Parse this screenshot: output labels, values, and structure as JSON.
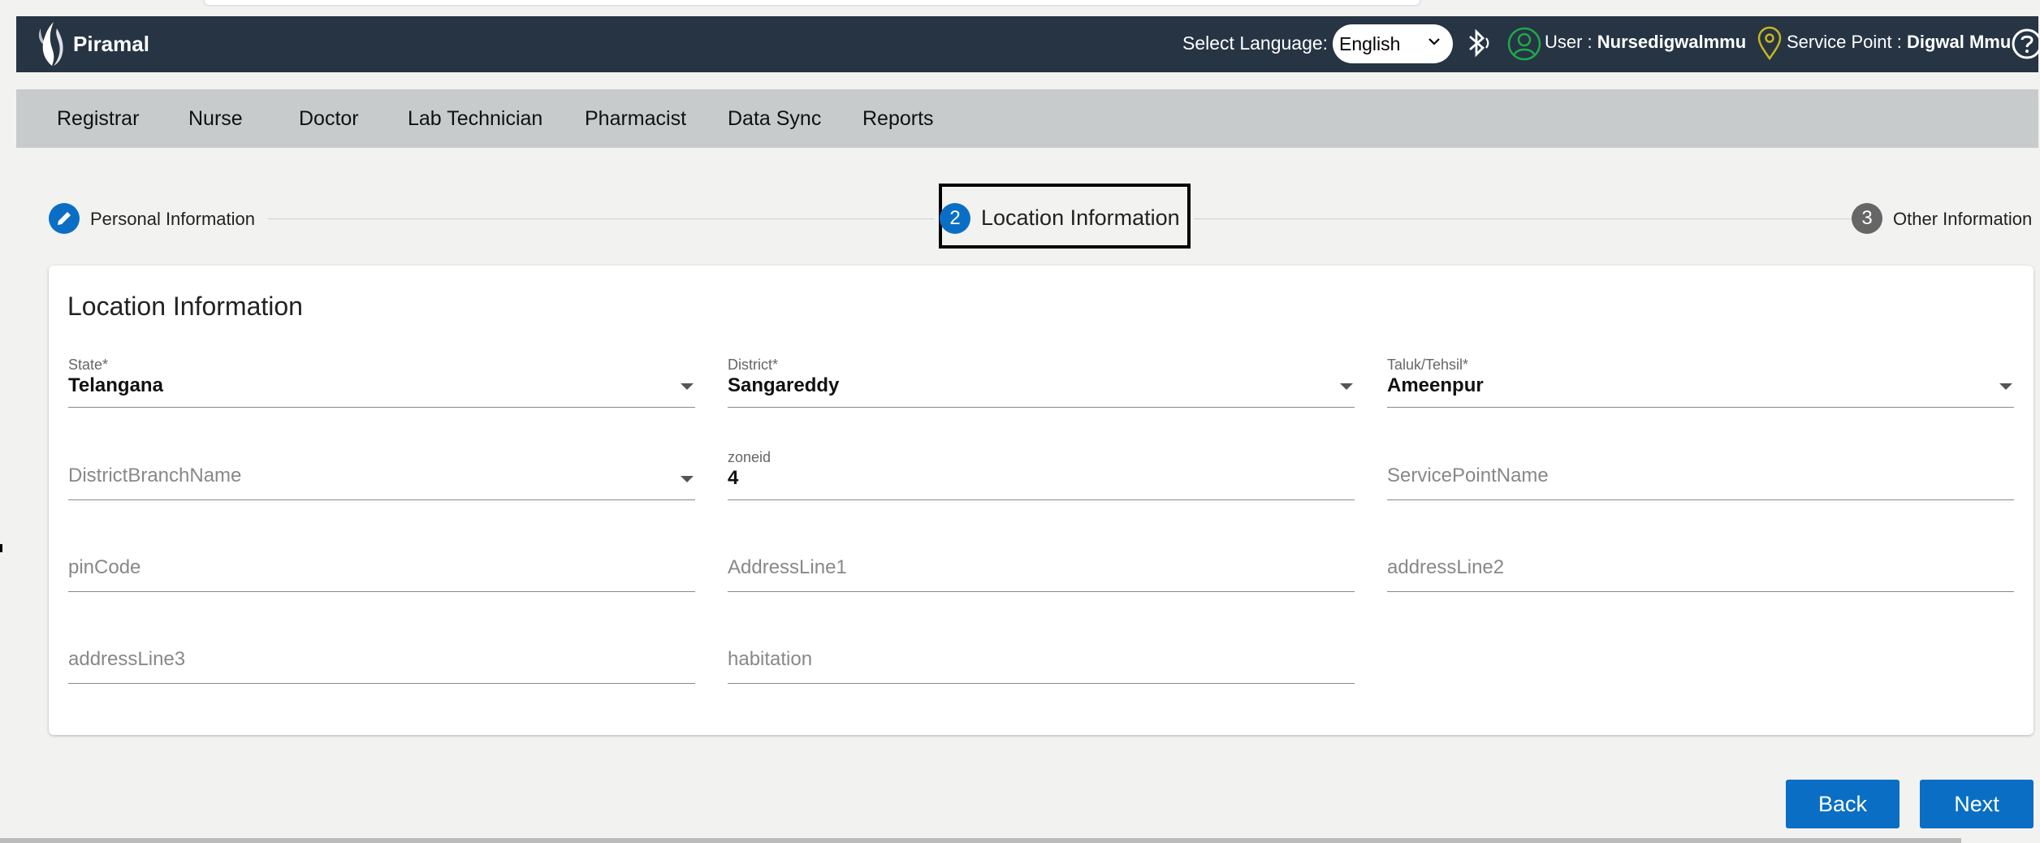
{
  "header": {
    "brand": "Piramal",
    "language_label": "Select Language:",
    "language_value": "English",
    "user_prefix": "User : ",
    "user_name": "Nursedigwalmmu",
    "service_point_prefix": "Service Point : ",
    "service_point_name": "Digwal Mmu"
  },
  "nav": {
    "items": [
      "Registrar",
      "Nurse",
      "Doctor",
      "Lab Technician",
      "Pharmacist",
      "Data Sync",
      "Reports"
    ]
  },
  "stepper": {
    "steps": [
      {
        "number": "",
        "label": "Personal Information",
        "state": "completed"
      },
      {
        "number": "2",
        "label": "Location Information",
        "state": "active"
      },
      {
        "number": "3",
        "label": "Other Information",
        "state": "pending"
      }
    ]
  },
  "card": {
    "title": "Location Information",
    "fields": {
      "state": {
        "label": "State*",
        "value": "Telangana"
      },
      "district": {
        "label": "District*",
        "value": "Sangareddy"
      },
      "taluk": {
        "label": "Taluk/Tehsil*",
        "value": "Ameenpur"
      },
      "district_branch": {
        "placeholder": "DistrictBranchName"
      },
      "zone": {
        "label": "zoneid",
        "value": "4"
      },
      "service_point_name": {
        "placeholder": "ServicePointName"
      },
      "pincode": {
        "placeholder": "pinCode"
      },
      "address1": {
        "placeholder": "AddressLine1"
      },
      "address2": {
        "placeholder": "addressLine2"
      },
      "address3": {
        "placeholder": "addressLine3"
      },
      "habitation": {
        "placeholder": "habitation"
      }
    }
  },
  "buttons": {
    "back": "Back",
    "next": "Next"
  },
  "colors": {
    "header_bg": "#263444",
    "primary": "#0a6fc4",
    "nav_bg": "#c7cbcc",
    "step_pending": "#666666"
  }
}
